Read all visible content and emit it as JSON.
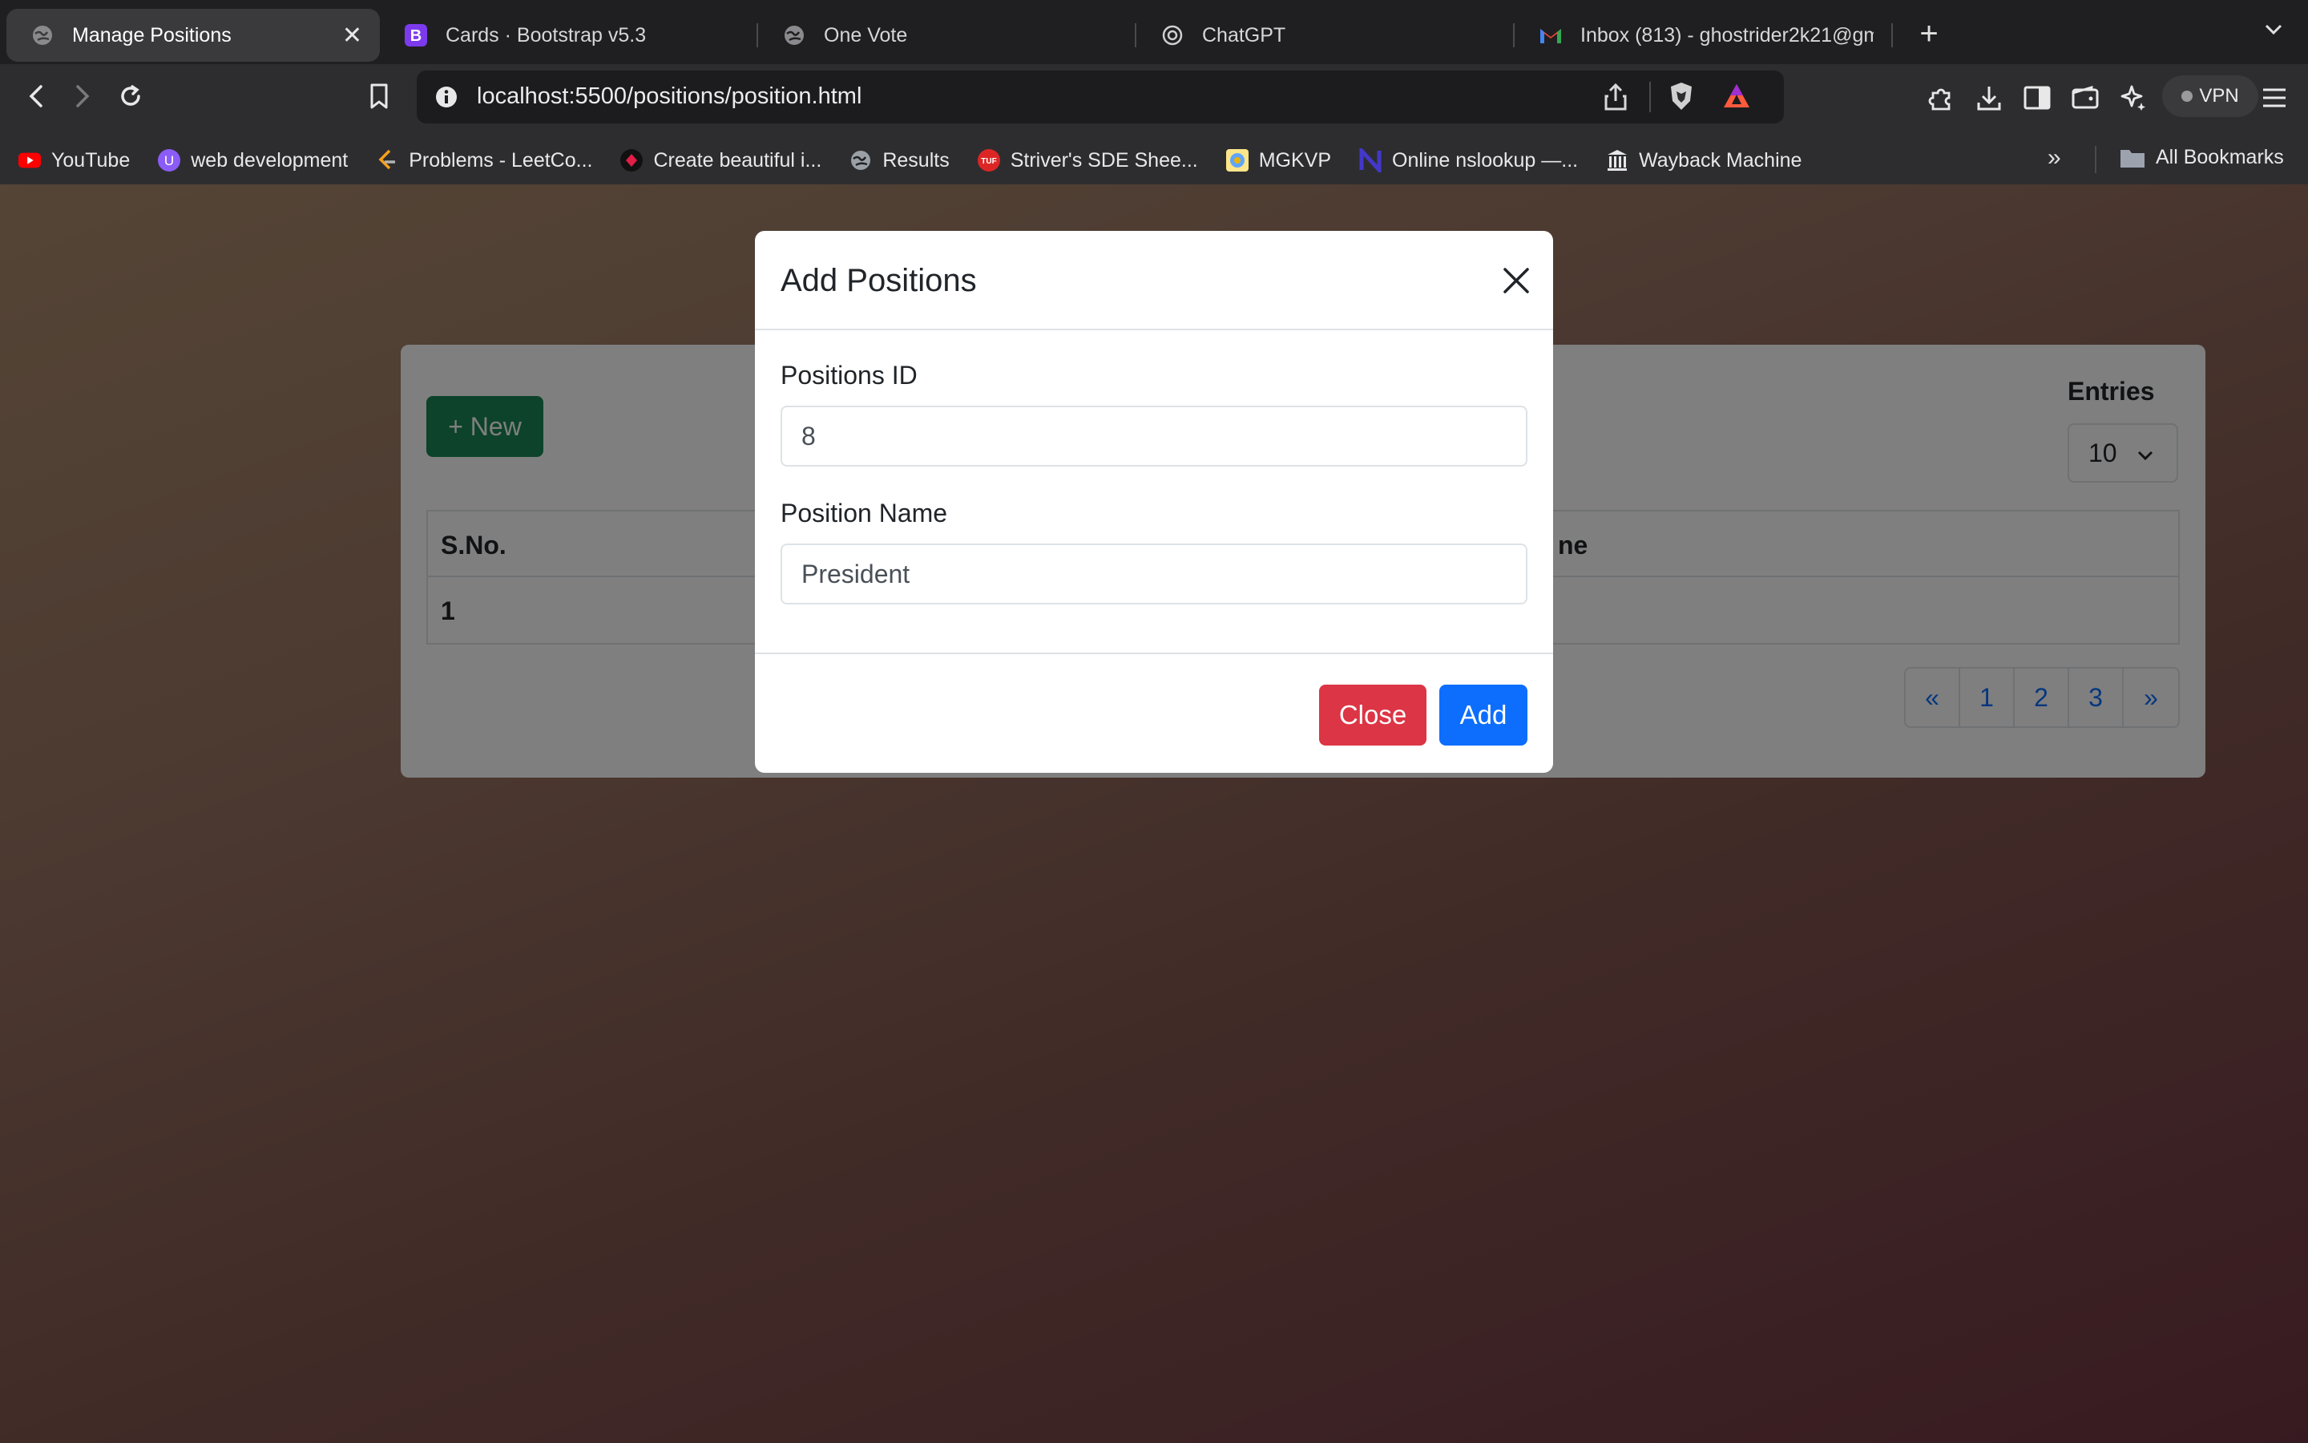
{
  "browser": {
    "tabs": [
      {
        "title": "Manage Positions",
        "active": true,
        "icon": "globe-icon"
      },
      {
        "title": "Cards · Bootstrap v5.3",
        "active": false,
        "icon": "bootstrap-icon"
      },
      {
        "title": "One Vote",
        "active": false,
        "icon": "globe-icon"
      },
      {
        "title": "ChatGPT",
        "active": false,
        "icon": "chatgpt-icon"
      },
      {
        "title": "Inbox (813) - ghostrider2k21@gm",
        "active": false,
        "icon": "gmail-icon"
      }
    ],
    "url": "localhost:5500/positions/position.html",
    "vpn_label": "VPN",
    "bookmarks": [
      {
        "label": "YouTube",
        "icon": "youtube-icon",
        "color": "#ff0000"
      },
      {
        "label": "web development",
        "icon": "folder-u-icon",
        "color": "#8b5cf6"
      },
      {
        "label": "Problems - LeetCo...",
        "icon": "leetcode-icon",
        "color": "#f89f1b"
      },
      {
        "label": "Create beautiful i...",
        "icon": "create-icon",
        "color": "#e11d48"
      },
      {
        "label": "Results",
        "icon": "globe-icon",
        "color": "#9aa0a6"
      },
      {
        "label": "Striver's SDE Shee...",
        "icon": "tuf-icon",
        "color": "#dc2626"
      },
      {
        "label": "MGKVP",
        "icon": "mgkvp-icon",
        "color": "#eab308"
      },
      {
        "label": "Online nslookup —...",
        "icon": "nslookup-icon",
        "color": "#4338ca"
      },
      {
        "label": "Wayback Machine",
        "icon": "wayback-icon",
        "color": "#e5e7eb"
      }
    ],
    "all_bookmarks": "All Bookmarks"
  },
  "page": {
    "new_button": "+ New",
    "entries_label": "Entries",
    "entries_value": "10",
    "table": {
      "headers": [
        "S.No.",
        "ne"
      ],
      "rows": [
        [
          "1",
          ""
        ]
      ]
    },
    "pagination": [
      "«",
      "1",
      "2",
      "3",
      "»"
    ]
  },
  "modal": {
    "title": "Add Positions",
    "id_label": "Positions ID",
    "id_value": "8",
    "name_label": "Position Name",
    "name_value": "President",
    "close_label": "Close",
    "add_label": "Add"
  },
  "colors": {
    "success": "#198754",
    "danger": "#dc3545",
    "primary": "#0d6efd"
  }
}
